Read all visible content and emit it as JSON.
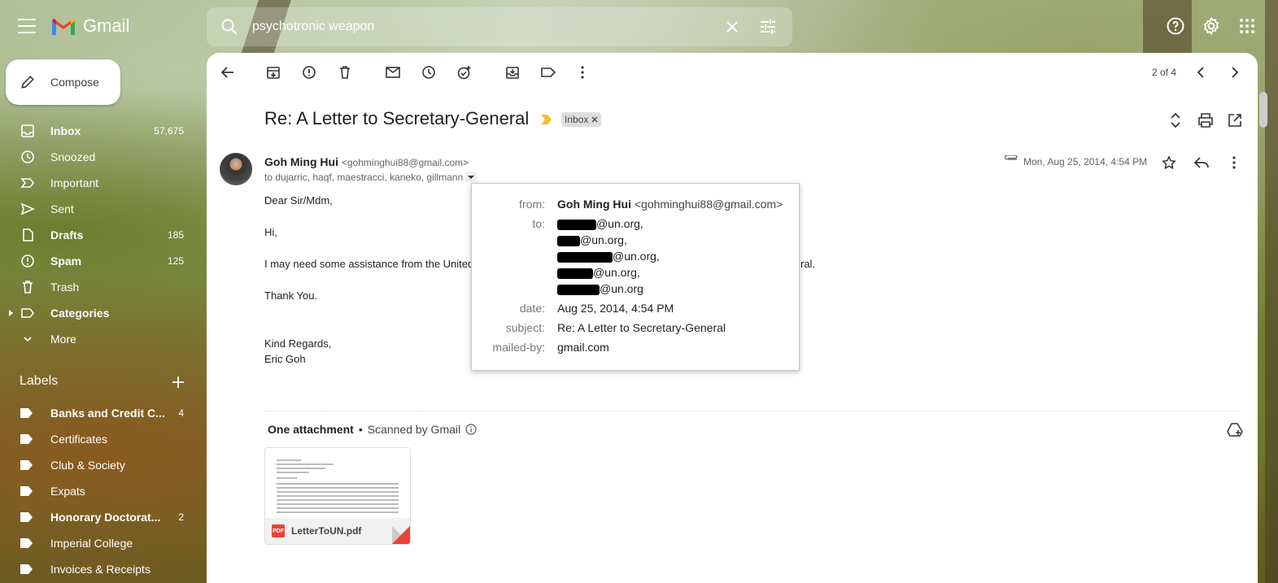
{
  "app": {
    "name": "Gmail"
  },
  "search": {
    "query": "psychotronic weapon"
  },
  "compose": {
    "label": "Compose"
  },
  "nav": [
    {
      "label": "Inbox",
      "count": "57,675",
      "bold": true
    },
    {
      "label": "Snoozed",
      "count": "",
      "bold": false
    },
    {
      "label": "Important",
      "count": "",
      "bold": false
    },
    {
      "label": "Sent",
      "count": "",
      "bold": false
    },
    {
      "label": "Drafts",
      "count": "185",
      "bold": true
    },
    {
      "label": "Spam",
      "count": "125",
      "bold": true
    },
    {
      "label": "Trash",
      "count": "",
      "bold": false
    },
    {
      "label": "Categories",
      "count": "",
      "bold": true
    },
    {
      "label": "More",
      "count": "",
      "bold": false
    }
  ],
  "labels": {
    "heading": "Labels",
    "items": [
      {
        "label": "Banks and Credit C...",
        "count": "4",
        "bold": true
      },
      {
        "label": "Certificates",
        "count": "",
        "bold": false
      },
      {
        "label": "Club & Society",
        "count": "",
        "bold": false
      },
      {
        "label": "Expats",
        "count": "",
        "bold": false
      },
      {
        "label": "Honorary Doctorat...",
        "count": "2",
        "bold": true
      },
      {
        "label": "Imperial College",
        "count": "",
        "bold": false
      },
      {
        "label": "Invoices & Receipts",
        "count": "",
        "bold": false
      }
    ]
  },
  "toolbar": {
    "pager": "2 of 4"
  },
  "email": {
    "subject": "Re: A Letter to Secretary-General",
    "inbox_chip": "Inbox",
    "sender_name": "Goh Ming Hui",
    "sender_email": "<gohminghui88@gmail.com>",
    "recipients": "to dujarric, haqf, maestracci, kaneko, gillmann",
    "date": "Mon, Aug 25, 2014, 4:54 PM",
    "body": {
      "greeting": "Dear Sir/Mdm,",
      "hi": "Hi,",
      "line_start": "I may need some assistance from the United",
      "line_end": "ral.",
      "thanks": "Thank You.",
      "regards": "Kind Regards,",
      "signature": "Eric Goh"
    },
    "attachment_heading": "One attachment",
    "scanned": "Scanned by Gmail",
    "attachment_name": "LetterToUN.pdf"
  },
  "popup": {
    "from_key": "from:",
    "from_name": "Goh Ming Hui",
    "from_email": "<gohminghui88@gmail.com>",
    "to_key": "to:",
    "to_lines": [
      "@un.org,",
      "@un.org,",
      "@un.org,",
      "@un.org,",
      "@un.org"
    ],
    "date_key": "date:",
    "date_val": "Aug 25, 2014, 4:54 PM",
    "subject_key": "subject:",
    "subject_val": "Re: A Letter to Secretary-General",
    "mailedby_key": "mailed-by:",
    "mailedby_val": "gmail.com"
  }
}
